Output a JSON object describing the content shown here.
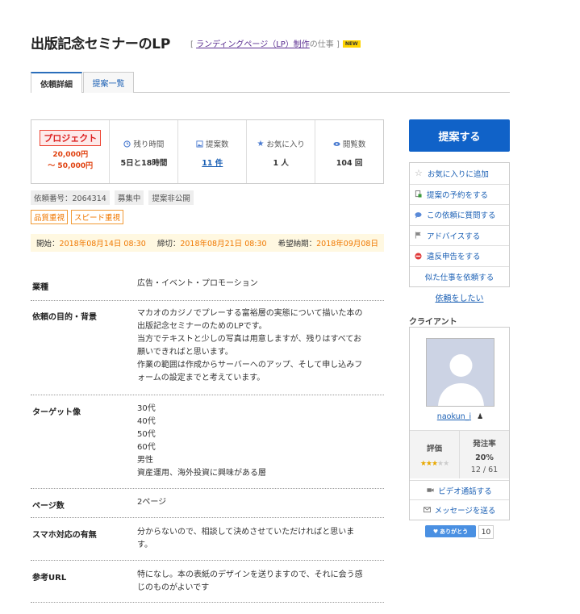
{
  "header": {
    "title": "出版記念セミナーのLP",
    "category_prefix": "[ ",
    "category_link": "ランディングページ（LP）制作",
    "category_suffix": "の仕事 ]",
    "new_badge": "NEW"
  },
  "tabs": [
    {
      "label": "依頼詳細",
      "active": true
    },
    {
      "label": "提案一覧",
      "active": false
    }
  ],
  "summary": {
    "project_badge": "プロジェクト",
    "price_min": "20,000円",
    "price_max": "～ 50,000円",
    "remaining_label": "残り時間",
    "remaining_value": "5日と18時間",
    "proposals_label": "提案数",
    "proposals_value": "11 件",
    "favorites_label": "お気に入り",
    "favorites_value": "1 人",
    "views_label": "閲覧数",
    "views_value": "104 回"
  },
  "meta": {
    "request_no": "依頼番号：2064314",
    "status": "募集中",
    "visibility": "提案非公開"
  },
  "tags": [
    "品質重視",
    "スピード重視"
  ],
  "dates": {
    "start_label": "開始：",
    "start": "2018年08月14日 08:30",
    "deadline_label": "締切：",
    "deadline": "2018年08月21日 08:30",
    "delivery_label": "希望納期：",
    "delivery": "2018年09月08日"
  },
  "details": [
    {
      "key": "業種",
      "value": "広告・イベント・プロモーション"
    },
    {
      "key": "依頼の目的・背景",
      "value": "マカオのカジノでプレーする富裕層の実態について描いた本の\n出版記念セミナーのためのLPです。\n当方でテキストと少しの写真は用意しますが、残りはすべてお\n願いできればと思います。\n作業の範囲は作成からサーバーへのアップ、そして申し込みフ\nォームの設定までと考えています。"
    },
    {
      "key": "ターゲット像",
      "value": "30代\n40代\n50代\n60代\n男性\n資産運用、海外投資に興味がある層"
    },
    {
      "key": "ページ数",
      "value": "2ページ"
    },
    {
      "key": "スマホ対応の有無",
      "value": "分からないので、相談して決めさせていただければと思いま\nす。"
    },
    {
      "key": "参考URL",
      "value": "特になし。本の表紙のデザインを送りますので、それに会う感\nじのものがよいです"
    }
  ],
  "sidebar": {
    "propose_button": "提案する",
    "actions": [
      {
        "label": "お気に入りに追加",
        "icon": "star-outline-icon"
      },
      {
        "label": "提案の予約をする",
        "icon": "document-add-icon"
      },
      {
        "label": "この依頼に質問する",
        "icon": "speech-bubble-icon"
      },
      {
        "label": "アドバイスする",
        "icon": "flag-icon"
      },
      {
        "label": "違反申告をする",
        "icon": "prohibited-icon"
      },
      {
        "label": "似た仕事を依頼する",
        "icon": ""
      }
    ],
    "not_want_link": "依頼をしたい",
    "client_label": "クライアント",
    "username": "naokun_i",
    "rating_label": "評価",
    "rating_stars": 3,
    "order_rate_label": "発注率",
    "order_rate": "20%",
    "order_count": "12 / 61",
    "video_call": "ビデオ通話する",
    "message": "メッセージを送る",
    "thanks_label": "ありがとう",
    "thanks_count": "10"
  }
}
